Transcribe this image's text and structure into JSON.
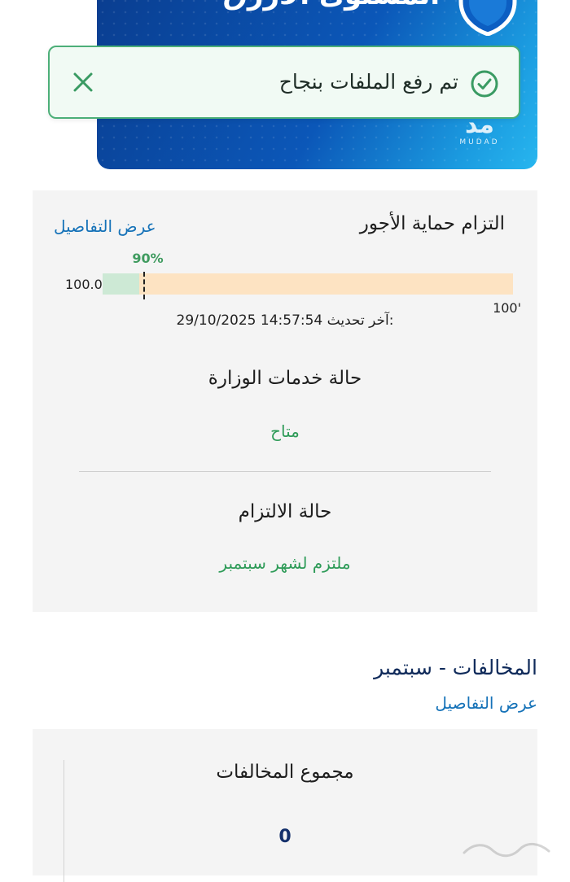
{
  "banner": {
    "title": "المستوى الأزرق",
    "logo_text": "MUDAD"
  },
  "toast": {
    "message": "تم رفع الملفات بنجاح"
  },
  "wage_protection": {
    "title": "التزام حماية الأجور",
    "details_link": "عرض التفاصيل",
    "target_label": "90%",
    "left_value": "100.0%",
    "right_value": "100'",
    "target_fraction": 0.9,
    "fill_fraction": 0.09,
    "last_update_label": "آخر تحديث:",
    "last_update_value": "29/10/2025 14:57:54"
  },
  "ministry_services": {
    "title": "حالة خدمات الوزارة",
    "status": "متاح"
  },
  "compliance": {
    "title": "حالة الالتزام",
    "status": "ملتزم لشهر سبتمبر"
  },
  "violations": {
    "title": "المخالفات - سبتمبر",
    "details_link": "عرض التفاصيل",
    "total_title": "مجموع المخالفات",
    "total_value": "0"
  },
  "colors": {
    "banner_blue": "#0b57b8",
    "toast_border": "#4caf78",
    "status_green": "#2e9b58",
    "link_blue": "#1572b8",
    "bar_track": "#fde3c2",
    "bar_fill": "#cde9d5"
  },
  "icons": {
    "shield": "shield-icon",
    "close": "close-icon",
    "check": "check-circle-icon"
  }
}
